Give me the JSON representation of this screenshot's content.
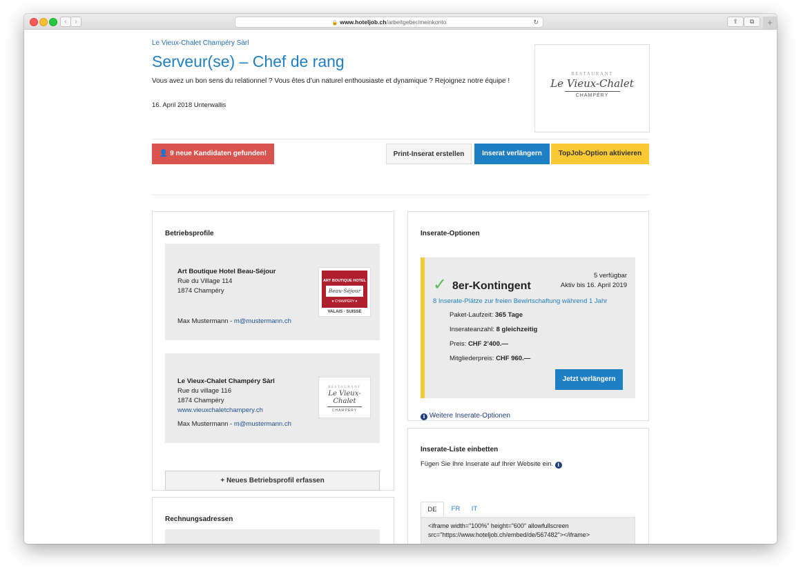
{
  "browser": {
    "url_domain": "www.hoteljob.ch",
    "url_path": "/arbeitgeber/meinkonto",
    "reload_icon": "reload-icon",
    "share_icon": "share-icon",
    "tabs_icon": "tabs-icon"
  },
  "job": {
    "company": "Le Vieux-Chalet Champéry Sàrl",
    "title": "Serveur(se) – Chef de rang",
    "intro": "Vous avez un bon sens du relationnel ? Vous êtes d’un naturel enthousiaste et dynamique ? Rejoignez notre équipe !",
    "date_region": "16. April 2018 Unterwallis",
    "logo": {
      "top": "RESTAURANT",
      "script": "Le Vieux-Chalet",
      "bottom": "CHAMPÉRY"
    }
  },
  "actions": {
    "candidates": "9 neue Kandidaten gefunden!",
    "print": "Print-Inserat erstellen",
    "extend": "Inserat verlängern",
    "topjob": "TopJob-Option aktivieren"
  },
  "profiles": {
    "heading": "Betriebsprofile",
    "items": [
      {
        "name": "Art Boutique Hotel Beau-Séjour",
        "street": "Rue du Village 114",
        "city": "1874 Champéry",
        "website": "",
        "contact_name": "Max Mustermann",
        "separator": " - ",
        "contact_email": "m@mustermann.ch",
        "logo_top": "ART BOUTIQUE HOTEL",
        "logo_script": "Beau-Séjour",
        "logo_bottom": "♥ CHAMPÉRY ♥",
        "logo_sub": "VALAIS · SUISSE"
      },
      {
        "name": "Le Vieux-Chalet Champéry Sàrl",
        "street": "Rue du village 116",
        "city": "1874 Champéry",
        "website": "www.vieuxchaletchampery.ch",
        "contact_name": "Max Mustermann",
        "separator": " - ",
        "contact_email": "m@mustermann.ch",
        "logo_top": "RESTAURANT",
        "logo_script": "Le Vieux-Chalet",
        "logo_bottom": "CHAMPÉRY"
      }
    ],
    "add_button": "Neues Betriebsprofil erfassen"
  },
  "billing": {
    "heading": "Rechnungsadressen"
  },
  "options": {
    "heading": "Inserate-Optionen",
    "package": "8er-Kontingent",
    "available": "5 verfügbar",
    "active_until": "Aktiv bis 16. April 2019",
    "description": "8 Inserate-Plätze zur freien Bewirtschaftung während 1 Jahr",
    "features": [
      {
        "label": "Paket-Laufzeit:",
        "value": "365 Tage"
      },
      {
        "label": "Inserateanzahl:",
        "value": "8 gleichzeitig"
      },
      {
        "label": "Preis:",
        "value": "CHF 2’400.—"
      },
      {
        "label": "Mitgliederpreis:",
        "value": "CHF 960.—"
      }
    ],
    "renew_button": "Jetzt verlängern",
    "more_link": "Weitere Inserate-Optionen"
  },
  "embed": {
    "heading": "Inserate-Liste einbetten",
    "description": "Fügen Sie Ihre Inserate auf Ihrer Website ein.",
    "tabs": [
      "DE",
      "FR",
      "IT"
    ],
    "code_line1": "<iframe width=\"100%\" height=\"600\" allowfullscreen",
    "code_line2": "src=\"https://www.hoteljob.ch/embed/de/567482\"></iframe>"
  },
  "colors": {
    "brand_blue": "#1f7fc4",
    "danger_red": "#d9534f",
    "warning_yellow": "#f9c933",
    "success_green": "#5cb85c"
  }
}
